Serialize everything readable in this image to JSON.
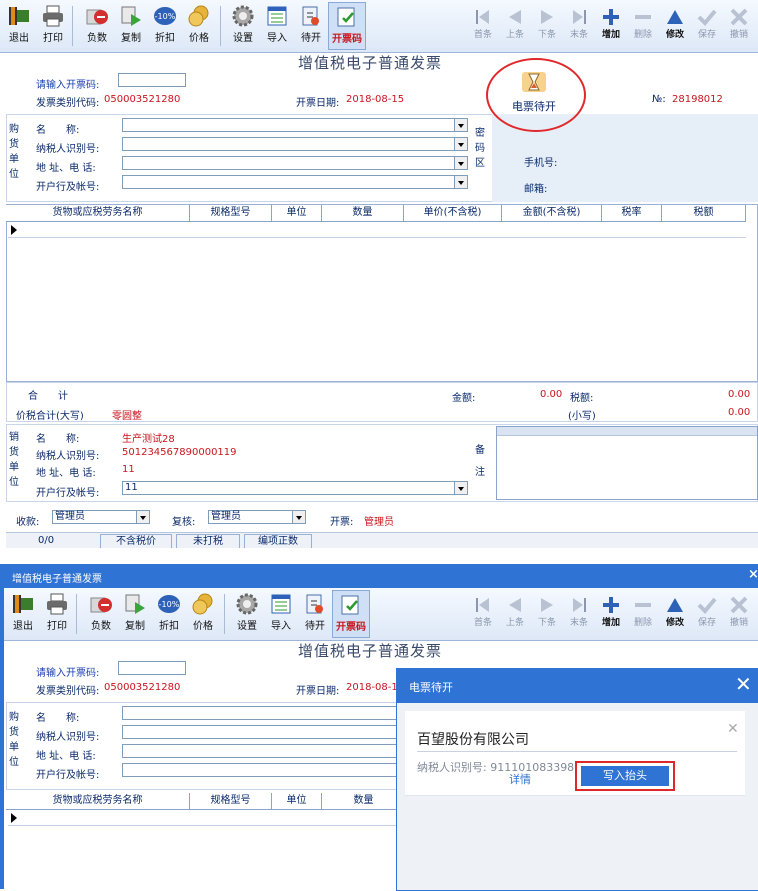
{
  "toolbar": {
    "exit": "退出",
    "print": "打印",
    "negative": "负数",
    "copy": "复制",
    "discount": "折扣",
    "discount_badge": "-10%",
    "price": "价格",
    "settings": "设置",
    "import": "导入",
    "pending": "待开",
    "invoice_code": "开票码",
    "first": "首条",
    "prev": "上条",
    "next": "下条",
    "last": "末条",
    "add": "增加",
    "delete": "删除",
    "modify": "修改",
    "save": "保存",
    "cancel": "撤销"
  },
  "invoice": {
    "title": "增值税电子普通发票",
    "code_prompt": "请输入开票码:",
    "type_code_label": "发票类别代码:",
    "type_code_value": "050003521280",
    "date_label": "开票日期:",
    "date_value": "2018-08-15",
    "no_label": "№:",
    "no_value": "28198012",
    "buyer_side": "购货单位",
    "seller_side": "销货单位",
    "name_label": "名　　称:",
    "taxid_label": "纳税人识别号:",
    "addr_label": "地 址、电 话:",
    "bank_label": "开户行及帐号:",
    "secret_side": "密码区",
    "phone_label": "手机号:",
    "email_label": "邮箱:",
    "pending_button": "电票待开",
    "columns": [
      "货物或应税劳务名称",
      "规格型号",
      "单位",
      "数量",
      "单价(不含税)",
      "金额(不含税)",
      "税率",
      "税额"
    ],
    "total_label": "合　　计",
    "amount_label": "金额:",
    "amount_value": "0.00",
    "tax_label": "税额:",
    "tax_value": "0.00",
    "sum_cn_label": "价税合计(大写)",
    "sum_cn_value": "零圆整",
    "sum_small_label": "(小写)",
    "sum_small_value": "0.00",
    "seller_name": "生产测试28",
    "seller_taxid": "501234567890000119",
    "seller_addr": "11",
    "seller_bank": "11",
    "remark_side": "备注",
    "payee_label": "收款:",
    "payee_value": "管理员",
    "reviewer_label": "复核:",
    "reviewer_value": "管理员",
    "drawer_label": "开票:",
    "drawer_value": "管理员",
    "status_items": [
      "0/0",
      "不含税价",
      "未打税",
      "编项正数"
    ]
  },
  "window2": {
    "title": "增值税电子普通发票"
  },
  "dialog": {
    "title": "电票待开",
    "company": "百望股份有限公司",
    "taxid_line": "纳税人识别号: 91110108339805094M",
    "detail": "详情",
    "write": "写入抬头"
  },
  "colors": {
    "accent": "#2f73d4",
    "red": "#c8161d",
    "label": "#0a2a6a"
  }
}
